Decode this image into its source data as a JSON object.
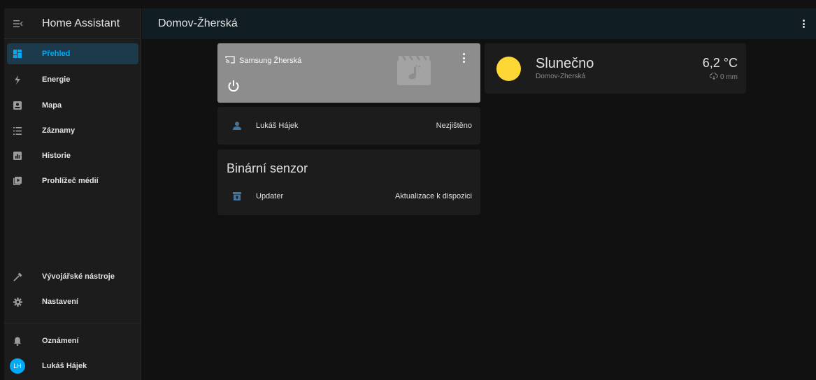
{
  "app": {
    "title": "Home Assistant"
  },
  "header": {
    "title": "Domov-Žherská"
  },
  "sidebar": {
    "items": [
      {
        "label": "Přehled",
        "icon": "dashboard-icon",
        "active": true
      },
      {
        "label": "Energie",
        "icon": "lightning-icon"
      },
      {
        "label": "Mapa",
        "icon": "map-icon"
      },
      {
        "label": "Záznamy",
        "icon": "list-icon"
      },
      {
        "label": "Historie",
        "icon": "chart-box-icon"
      },
      {
        "label": "Prohlížeč médií",
        "icon": "media-play-icon"
      }
    ],
    "bottom": [
      {
        "label": "Vývojářské nástroje",
        "icon": "hammer-icon"
      },
      {
        "label": "Nastavení",
        "icon": "gear-icon"
      }
    ],
    "notifications_label": "Oznámení",
    "user": {
      "initials": "LH",
      "name": "Lukáš Hájek"
    }
  },
  "cards": {
    "media": {
      "name": "Samsung Žherská"
    },
    "person": {
      "name": "Lukáš Hájek",
      "state": "Nezjištěno"
    },
    "binary_sensor": {
      "title": "Binární senzor",
      "row": {
        "name": "Updater",
        "state": "Aktualizace k dispozici"
      }
    },
    "weather": {
      "state": "Slunečno",
      "name": "Domov-Zherská",
      "temperature": "6,2 °C",
      "precipitation": "0 mm",
      "sun_color": "#fdd835"
    }
  },
  "colors": {
    "accent": "#03a9f4",
    "header_bg": "#101e24",
    "sidebar_bg": "#1c1c1c",
    "card_bg": "#1c1c1c"
  }
}
